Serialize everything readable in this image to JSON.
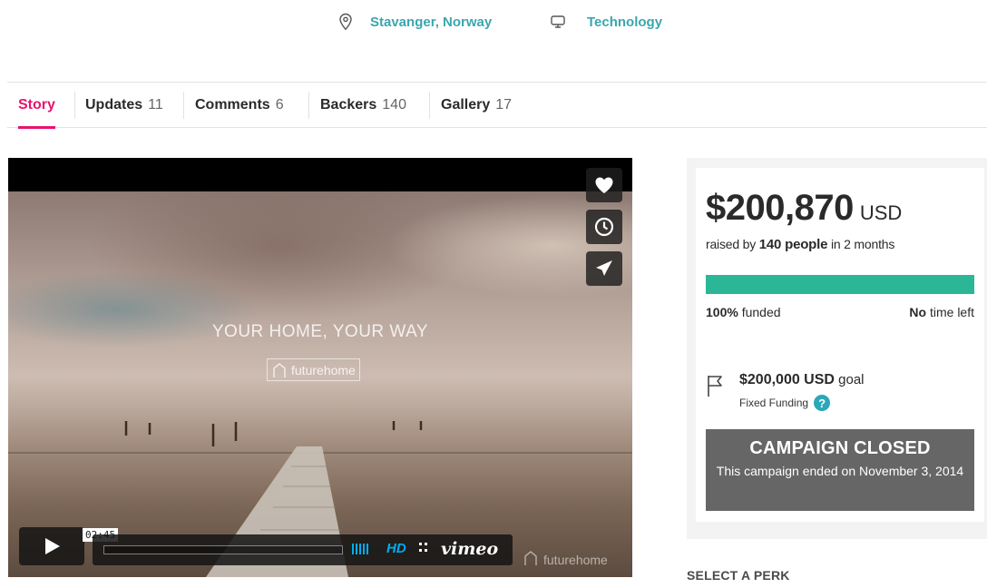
{
  "meta": {
    "location": "Stavanger, Norway",
    "category": "Technology"
  },
  "tabs": [
    {
      "label": "Story",
      "count": ""
    },
    {
      "label": "Updates",
      "count": "11"
    },
    {
      "label": "Comments",
      "count": "6"
    },
    {
      "label": "Backers",
      "count": "140"
    },
    {
      "label": "Gallery",
      "count": "17"
    }
  ],
  "video": {
    "title": "YOUR HOME, YOUR WAY",
    "logo_prefix": "future",
    "logo_suffix": "home",
    "timecode": "02:45",
    "hd_label": "HD",
    "vimeo_label": "vimeo",
    "progress_fraction": 0,
    "accent_color": "#00adef"
  },
  "funding": {
    "amount": "$200,870",
    "currency": "USD",
    "raised_prefix": "raised by",
    "raised_people": "140 people",
    "raised_suffix": "in 2 months",
    "percent_label": "100%",
    "funded_label": "funded",
    "time_left_bold": "No",
    "time_left_rest": "time left",
    "progress_fraction": 1.0,
    "bar_color": "#2bb697",
    "goal_amount": "$200,000 USD",
    "goal_label": "goal",
    "funding_type": "Fixed Funding",
    "help_glyph": "?",
    "closed_title": "CAMPAIGN CLOSED",
    "closed_text": "This campaign ended on November 3, 2014"
  },
  "perks": {
    "heading": "SELECT A PERK"
  },
  "colors": {
    "accent_teal": "#3aa7ad",
    "tab_active": "#e6136e",
    "closed_bg": "#666666"
  }
}
